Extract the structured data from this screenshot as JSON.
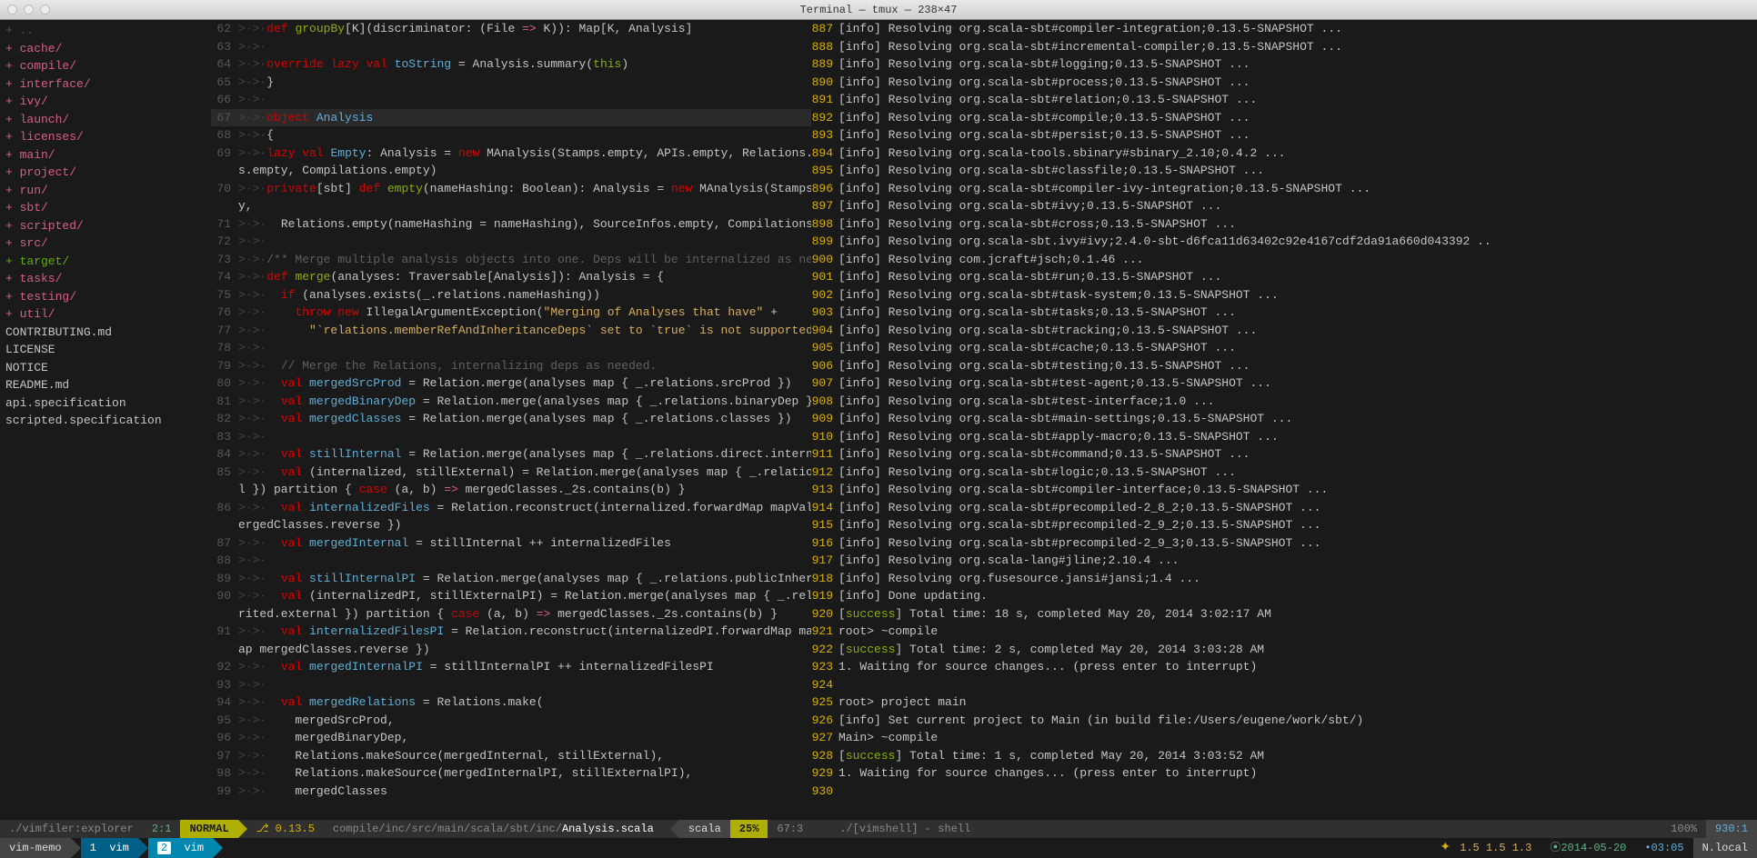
{
  "window": {
    "title": "Terminal — tmux — 238×47"
  },
  "filetree": [
    {
      "t": "..",
      "cls": "dots"
    },
    {
      "t": "cache/",
      "cls": "dir"
    },
    {
      "t": "compile/",
      "cls": "dir"
    },
    {
      "t": "interface/",
      "cls": "dir"
    },
    {
      "t": "ivy/",
      "cls": "dir"
    },
    {
      "t": "launch/",
      "cls": "dir"
    },
    {
      "t": "licenses/",
      "cls": "dir"
    },
    {
      "t": "main/",
      "cls": "dir"
    },
    {
      "t": "project/",
      "cls": "dir"
    },
    {
      "t": "run/",
      "cls": "dir"
    },
    {
      "t": "sbt/",
      "cls": "dir"
    },
    {
      "t": "scripted/",
      "cls": "dir"
    },
    {
      "t": "src/",
      "cls": "dir"
    },
    {
      "t": "target/",
      "cls": "dir green"
    },
    {
      "t": "tasks/",
      "cls": "dir"
    },
    {
      "t": "testing/",
      "cls": "dir"
    },
    {
      "t": "util/",
      "cls": "dir"
    },
    {
      "t": "CONTRIBUTING.md",
      "cls": "fileplain"
    },
    {
      "t": "LICENSE",
      "cls": "fileplain"
    },
    {
      "t": "NOTICE",
      "cls": "fileplain"
    },
    {
      "t": "README.md",
      "cls": "fileplain"
    },
    {
      "t": "api.specification",
      "cls": "fileplain"
    },
    {
      "t": "scripted.specification",
      "cls": "fileplain"
    }
  ],
  "code": [
    {
      "n": "62",
      "html": "<span class='kw-red'>def</span> <span class='kw-green'>groupBy</span>[K](discriminator: (File <span class='kw-pink'>=&gt;</span> K)): Map[K, Analysis]"
    },
    {
      "n": "63",
      "html": ""
    },
    {
      "n": "64",
      "html": "<span class='kw-red'>override</span> <span class='kw-red'>lazy</span> <span class='kw-red'>val</span> <span class='kw-blue'>toString</span> = Analysis.summary(<span class='kw-green'>this</span>)"
    },
    {
      "n": "65",
      "html": "}"
    },
    {
      "n": "66",
      "html": ""
    },
    {
      "n": "67",
      "html": "<span class='kw-red'>object</span> <span class='kw-blue'>Analysis</span>",
      "hl": true
    },
    {
      "n": "68",
      "html": "{"
    },
    {
      "n": "69",
      "html": "<span class='kw-red'>lazy</span> <span class='kw-red'>val</span> <span class='kw-blue'>Empty</span>: Analysis = <span class='kw-red'>new</span> MAnalysis(Stamps.empty, APIs.empty, Relations.empty, SourceInfo"
    },
    {
      "n": "  ",
      "html": "s.empty, Compilations.empty)"
    },
    {
      "n": "70",
      "html": "<span class='kw-red'>private</span>[sbt] <span class='kw-red'>def</span> <span class='kw-green'>empty</span>(nameHashing: Boolean): Analysis = <span class='kw-red'>new</span> MAnalysis(Stamps.empty, APIs.empt"
    },
    {
      "n": "  ",
      "html": "y,"
    },
    {
      "n": "71",
      "html": "  Relations.empty(nameHashing = nameHashing), SourceInfos.empty, Compilations.empty)"
    },
    {
      "n": "72",
      "html": ""
    },
    {
      "n": "73",
      "html": "<span class='comment'>/** Merge multiple analysis objects into one. Deps will be internalized as needed. */</span>"
    },
    {
      "n": "74",
      "html": "<span class='kw-red'>def</span> <span class='kw-green'>merge</span>(analyses: Traversable[Analysis]): Analysis = {"
    },
    {
      "n": "75",
      "html": "  <span class='kw-red'>if</span> (analyses.exists(_.relations.nameHashing))"
    },
    {
      "n": "76",
      "html": "    <span class='kw-red'>throw</span> <span class='kw-red'>new</span> IllegalArgumentException(<span class='str'>\"Merging of Analyses that have\"</span> +"
    },
    {
      "n": "77",
      "html": "      <span class='str'>\"`relations.memberRefAndInheritanceDeps` set to `true` is not supported.\"</span>)"
    },
    {
      "n": "78",
      "html": ""
    },
    {
      "n": "79",
      "html": "  <span class='comment'>// Merge the Relations, internalizing deps as needed.</span>"
    },
    {
      "n": "80",
      "html": "  <span class='kw-red'>val</span> <span class='kw-blue'>mergedSrcProd</span> = Relation.merge(analyses map { _.relations.srcProd })"
    },
    {
      "n": "81",
      "html": "  <span class='kw-red'>val</span> <span class='kw-blue'>mergedBinaryDep</span> = Relation.merge(analyses map { _.relations.binaryDep })"
    },
    {
      "n": "82",
      "html": "  <span class='kw-red'>val</span> <span class='kw-blue'>mergedClasses</span> = Relation.merge(analyses map { _.relations.classes })"
    },
    {
      "n": "83",
      "html": ""
    },
    {
      "n": "84",
      "html": "  <span class='kw-red'>val</span> <span class='kw-blue'>stillInternal</span> = Relation.merge(analyses map { _.relations.direct.internal })"
    },
    {
      "n": "85",
      "html": "  <span class='kw-red'>val</span> (internalized, stillExternal) = Relation.merge(analyses map { _.relations.direct.externa"
    },
    {
      "n": "  ",
      "html": "l }) partition { <span class='kw-red'>case</span> (a, b) <span class='kw-pink'>=&gt;</span> mergedClasses._2s.contains(b) }"
    },
    {
      "n": "86",
      "html": "  <span class='kw-red'>val</span> <span class='kw-blue'>internalizedFiles</span> = Relation.reconstruct(internalized.forwardMap mapValues { _ flatMap m"
    },
    {
      "n": "  ",
      "html": "ergedClasses.reverse })"
    },
    {
      "n": "87",
      "html": "  <span class='kw-red'>val</span> <span class='kw-blue'>mergedInternal</span> = stillInternal ++ internalizedFiles"
    },
    {
      "n": "88",
      "html": ""
    },
    {
      "n": "89",
      "html": "  <span class='kw-red'>val</span> <span class='kw-blue'>stillInternalPI</span> = Relation.merge(analyses map { _.relations.publicInherited.internal })"
    },
    {
      "n": "90",
      "html": "  <span class='kw-red'>val</span> (internalizedPI, stillExternalPI) = Relation.merge(analyses map { _.relations.publicInhe"
    },
    {
      "n": "  ",
      "html": "rited.external }) partition { <span class='kw-red'>case</span> (a, b) <span class='kw-pink'>=&gt;</span> mergedClasses._2s.contains(b) }"
    },
    {
      "n": "91",
      "html": "  <span class='kw-red'>val</span> <span class='kw-blue'>internalizedFilesPI</span> = Relation.reconstruct(internalizedPI.forwardMap mapValues { _ flatM"
    },
    {
      "n": "  ",
      "html": "ap mergedClasses.reverse })"
    },
    {
      "n": "92",
      "html": "  <span class='kw-red'>val</span> <span class='kw-blue'>mergedInternalPI</span> = stillInternalPI ++ internalizedFilesPI"
    },
    {
      "n": "93",
      "html": ""
    },
    {
      "n": "94",
      "html": "  <span class='kw-red'>val</span> <span class='kw-blue'>mergedRelations</span> = Relations.make("
    },
    {
      "n": "95",
      "html": "    mergedSrcProd,"
    },
    {
      "n": "96",
      "html": "    mergedBinaryDep,"
    },
    {
      "n": "97",
      "html": "    Relations.makeSource(mergedInternal, stillExternal),"
    },
    {
      "n": "98",
      "html": "    Relations.makeSource(mergedInternalPI, stillExternalPI),"
    },
    {
      "n": "99",
      "html": "    mergedClasses"
    }
  ],
  "log": [
    {
      "n": "887",
      "t": "[info] Resolving org.scala-sbt#compiler-integration;0.13.5-SNAPSHOT ..."
    },
    {
      "n": "888",
      "t": "[info] Resolving org.scala-sbt#incremental-compiler;0.13.5-SNAPSHOT ..."
    },
    {
      "n": "889",
      "t": "[info] Resolving org.scala-sbt#logging;0.13.5-SNAPSHOT ..."
    },
    {
      "n": "890",
      "t": "[info] Resolving org.scala-sbt#process;0.13.5-SNAPSHOT ..."
    },
    {
      "n": "891",
      "t": "[info] Resolving org.scala-sbt#relation;0.13.5-SNAPSHOT ..."
    },
    {
      "n": "892",
      "t": "[info] Resolving org.scala-sbt#compile;0.13.5-SNAPSHOT ..."
    },
    {
      "n": "893",
      "t": "[info] Resolving org.scala-sbt#persist;0.13.5-SNAPSHOT ..."
    },
    {
      "n": "894",
      "t": "[info] Resolving org.scala-tools.sbinary#sbinary_2.10;0.4.2 ..."
    },
    {
      "n": "895",
      "t": "[info] Resolving org.scala-sbt#classfile;0.13.5-SNAPSHOT ..."
    },
    {
      "n": "896",
      "t": "[info] Resolving org.scala-sbt#compiler-ivy-integration;0.13.5-SNAPSHOT ..."
    },
    {
      "n": "897",
      "t": "[info] Resolving org.scala-sbt#ivy;0.13.5-SNAPSHOT ..."
    },
    {
      "n": "898",
      "t": "[info] Resolving org.scala-sbt#cross;0.13.5-SNAPSHOT ..."
    },
    {
      "n": "899",
      "t": "[info] Resolving org.scala-sbt.ivy#ivy;2.4.0-sbt-d6fca11d63402c92e4167cdf2da91a660d043392 .."
    },
    {
      "n": "900",
      "t": "[info] Resolving com.jcraft#jsch;0.1.46 ..."
    },
    {
      "n": "901",
      "t": "[info] Resolving org.scala-sbt#run;0.13.5-SNAPSHOT ..."
    },
    {
      "n": "902",
      "t": "[info] Resolving org.scala-sbt#task-system;0.13.5-SNAPSHOT ..."
    },
    {
      "n": "903",
      "t": "[info] Resolving org.scala-sbt#tasks;0.13.5-SNAPSHOT ..."
    },
    {
      "n": "904",
      "t": "[info] Resolving org.scala-sbt#tracking;0.13.5-SNAPSHOT ..."
    },
    {
      "n": "905",
      "t": "[info] Resolving org.scala-sbt#cache;0.13.5-SNAPSHOT ..."
    },
    {
      "n": "906",
      "t": "[info] Resolving org.scala-sbt#testing;0.13.5-SNAPSHOT ..."
    },
    {
      "n": "907",
      "t": "[info] Resolving org.scala-sbt#test-agent;0.13.5-SNAPSHOT ..."
    },
    {
      "n": "908",
      "t": "[info] Resolving org.scala-sbt#test-interface;1.0 ..."
    },
    {
      "n": "909",
      "t": "[info] Resolving org.scala-sbt#main-settings;0.13.5-SNAPSHOT ..."
    },
    {
      "n": "910",
      "t": "[info] Resolving org.scala-sbt#apply-macro;0.13.5-SNAPSHOT ..."
    },
    {
      "n": "911",
      "t": "[info] Resolving org.scala-sbt#command;0.13.5-SNAPSHOT ..."
    },
    {
      "n": "912",
      "t": "[info] Resolving org.scala-sbt#logic;0.13.5-SNAPSHOT ..."
    },
    {
      "n": "913",
      "t": "[info] Resolving org.scala-sbt#compiler-interface;0.13.5-SNAPSHOT ..."
    },
    {
      "n": "914",
      "t": "[info] Resolving org.scala-sbt#precompiled-2_8_2;0.13.5-SNAPSHOT ..."
    },
    {
      "n": "915",
      "t": "[info] Resolving org.scala-sbt#precompiled-2_9_2;0.13.5-SNAPSHOT ..."
    },
    {
      "n": "916",
      "t": "[info] Resolving org.scala-sbt#precompiled-2_9_3;0.13.5-SNAPSHOT ..."
    },
    {
      "n": "917",
      "t": "[info] Resolving org.scala-lang#jline;2.10.4 ..."
    },
    {
      "n": "918",
      "t": "[info] Resolving org.fusesource.jansi#jansi;1.4 ..."
    },
    {
      "n": "919",
      "t": "[info] Done updating."
    },
    {
      "n": "920",
      "t": "[success] Total time: 18 s, completed May 20, 2014 3:02:17 AM",
      "success": true
    },
    {
      "n": "921",
      "t": "root> ~compile"
    },
    {
      "n": "922",
      "t": "[success] Total time: 2 s, completed May 20, 2014 3:03:28 AM",
      "success": true
    },
    {
      "n": "923",
      "t": "1. Waiting for source changes... (press enter to interrupt)"
    },
    {
      "n": "924",
      "t": ""
    },
    {
      "n": "925",
      "t": "root> project main"
    },
    {
      "n": "926",
      "t": "[info] Set current project to Main (in build file:/Users/eugene/work/sbt/)"
    },
    {
      "n": "927",
      "t": "Main> ~compile"
    },
    {
      "n": "928",
      "t": "[success] Total time: 1 s, completed May 20, 2014 3:03:52 AM",
      "success": true
    },
    {
      "n": "929",
      "t": "1. Waiting for source changes... (press enter to interrupt)"
    },
    {
      "n": "930",
      "t": ""
    }
  ],
  "status_left": {
    "explorer": "./vimfiler:explorer",
    "pos1": "2:1",
    "mode": "NORMAL",
    "branch": "⎇ 0.13.5",
    "path_prefix": "compile/inc/src/main/scala/sbt/inc/",
    "path_file": "Analysis.scala",
    "filetype": "scala",
    "percent": "25%",
    "cursor": "67:3"
  },
  "status_right": {
    "shell": "./[vimshell] - shell",
    "percent": "100%",
    "cursor": "930:1"
  },
  "tmux": {
    "session": "vim-memo",
    "win1_idx": "1",
    "win1_name": "vim",
    "win2_idx": "2",
    "win2_name": "vim",
    "load": "1.5 1.5 1.3",
    "date": "⦿2014-05-20",
    "time": "•03:05",
    "host": "N.local"
  }
}
